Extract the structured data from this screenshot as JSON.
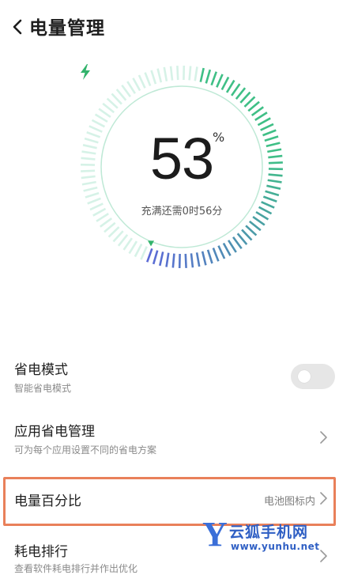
{
  "header": {
    "title": "电量管理",
    "back_icon": "chevron-left-icon"
  },
  "battery": {
    "level_percent": 53,
    "level_text": "53",
    "unit": "%",
    "remaining_text": "充满还需0时56分",
    "charging_icon": "lightning-bolt-icon",
    "colors": {
      "fill_start": "#3fbf86",
      "fill_end": "#5b6ad6",
      "track": "#d6f2e7",
      "inner_ring": "#bfe9d6",
      "bolt": "#31b36b"
    }
  },
  "settings": [
    {
      "title": "省电模式",
      "subtitle": "智能省电模式",
      "control": "toggle",
      "toggle_on": false
    },
    {
      "title": "应用省电管理",
      "subtitle": "可为每个应用设置不同的省电方案",
      "control": "chevron"
    },
    {
      "title": "电量百分比",
      "value": "电池图标内",
      "control": "chevron",
      "highlighted": true
    },
    {
      "title": "耗电排行",
      "subtitle": "查看软件耗电排行并作出优化",
      "control": "chevron"
    }
  ],
  "highlight_color": "#e9805a",
  "watermark": {
    "logo": "Y",
    "name": "云狐手机网",
    "url": "www.yunhu.net"
  }
}
